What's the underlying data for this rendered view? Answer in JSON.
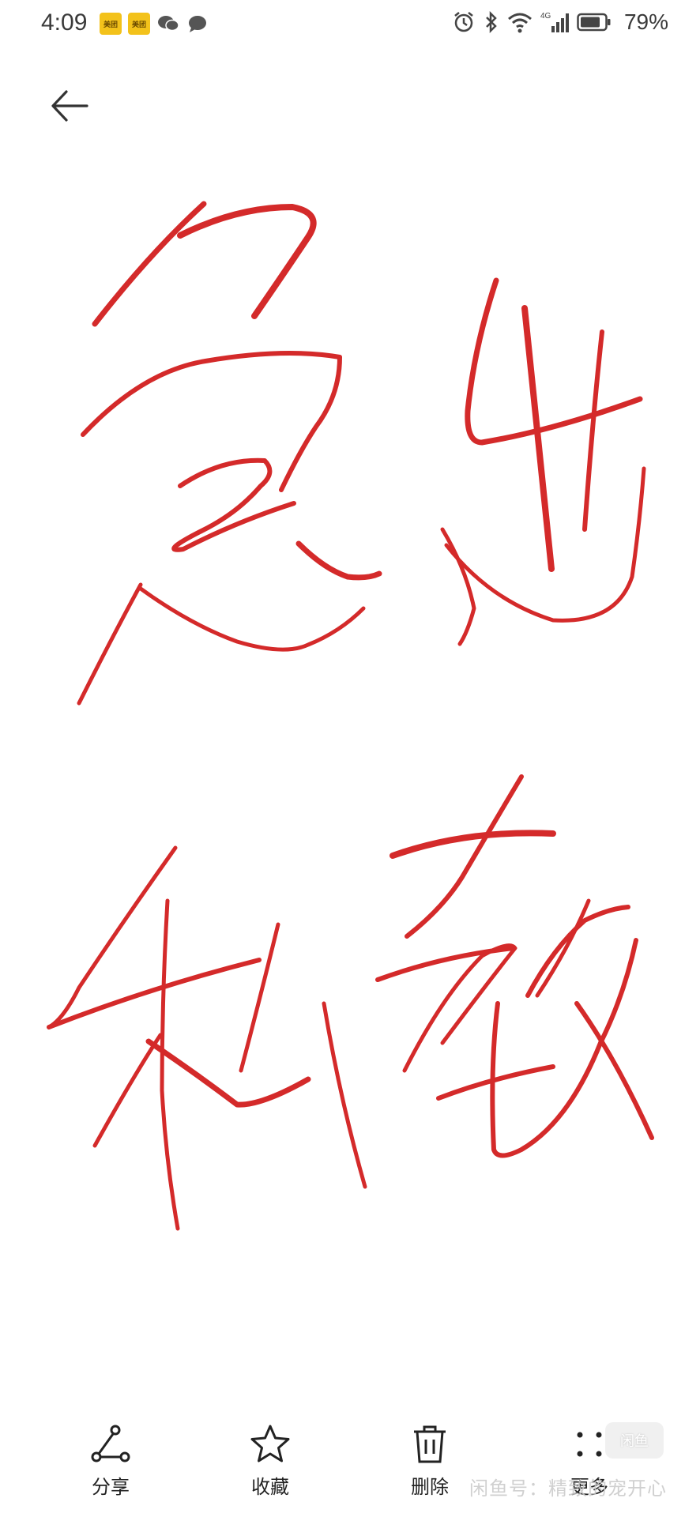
{
  "status_bar": {
    "time": "4:09",
    "notification_icons": [
      "app-badge",
      "app-badge",
      "wechat-icon",
      "message-icon"
    ],
    "app_badge_text": "美团",
    "battery_percent": "79%",
    "network_label": "4G"
  },
  "header": {
    "back_icon": "back-arrow-icon"
  },
  "toolbar": {
    "items": [
      {
        "label": "分享",
        "icon": "share-icon"
      },
      {
        "label": "收藏",
        "icon": "star-icon"
      },
      {
        "label": "删除",
        "icon": "trash-icon"
      },
      {
        "label": "更多",
        "icon": "more-icon"
      }
    ]
  },
  "watermark": {
    "box": "闲鱼",
    "text": "闲鱼号：精致的宠开心"
  },
  "colors": {
    "ink": "#d42a2a",
    "icon": "#222222"
  }
}
